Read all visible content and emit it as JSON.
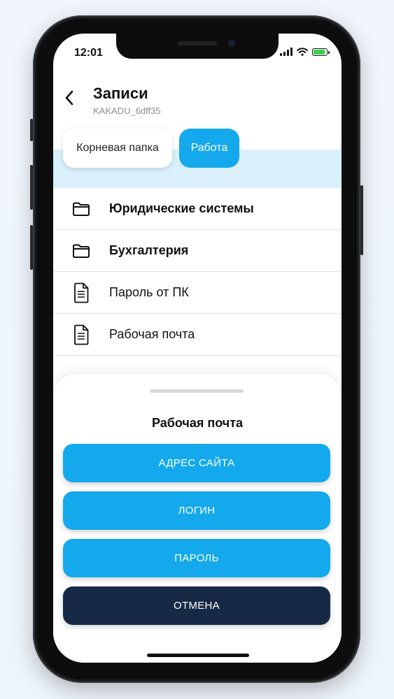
{
  "status_bar": {
    "time": "12:01"
  },
  "header": {
    "title": "Записи",
    "subtitle": "KAKADU_6dff35"
  },
  "breadcrumbs": [
    {
      "label": "Корневая папка",
      "active": false
    },
    {
      "label": "Работа",
      "active": true
    }
  ],
  "items": [
    {
      "label": "Юридические системы",
      "type": "folder",
      "icon": "folder-icon"
    },
    {
      "label": "Бухгалтерия",
      "type": "folder",
      "icon": "folder-icon"
    },
    {
      "label": "Пароль от ПК",
      "type": "document",
      "icon": "document-icon"
    },
    {
      "label": "Рабочая почта",
      "type": "document",
      "icon": "document-icon"
    }
  ],
  "sheet": {
    "title": "Рабочая почта",
    "buttons": {
      "site_address": "АДРЕС САЙТА",
      "login": "ЛОГИН",
      "password": "ПАРОЛЬ",
      "cancel": "ОТМЕНА"
    }
  },
  "colors": {
    "accent": "#13a9ec",
    "cancel": "#172a45",
    "breadcrumb_band": "#d9eff9",
    "battery": "#3ccf4e"
  }
}
